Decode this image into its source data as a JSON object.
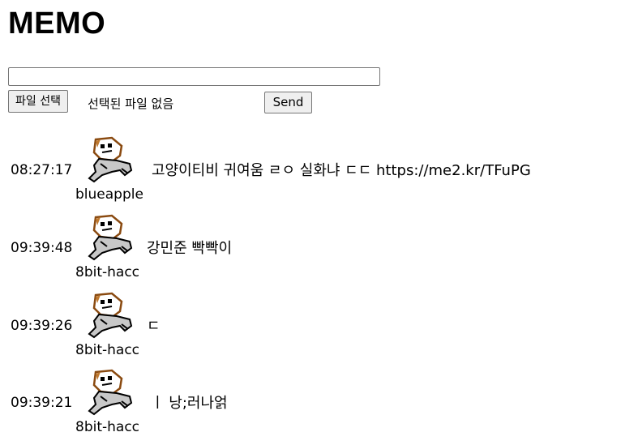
{
  "header": {
    "title": "MEMO"
  },
  "form": {
    "memo_value": "",
    "file_button_label": "파일 선택",
    "file_status": "선택된 파일 없음",
    "send_label": "Send"
  },
  "messages": [
    {
      "time": "08:27:17",
      "text": "고양이티비 귀여움 ㄹㅇ 실화냐 ㄷㄷ https://me2.kr/TFuPG",
      "user": "blueapple",
      "avatar": "cartoon-avatar-icon"
    },
    {
      "time": "09:39:48",
      "text": "강민준 빡빡이",
      "user": "8bit-hacc",
      "avatar": "cartoon-avatar-icon"
    },
    {
      "time": "09:39:26",
      "text": "ㄷ",
      "user": "8bit-hacc",
      "avatar": "cartoon-avatar-icon"
    },
    {
      "time": "09:39:21",
      "text": "ㅣ 낭;러나얽",
      "user": "8bit-hacc",
      "avatar": "cartoon-avatar-icon"
    }
  ]
}
